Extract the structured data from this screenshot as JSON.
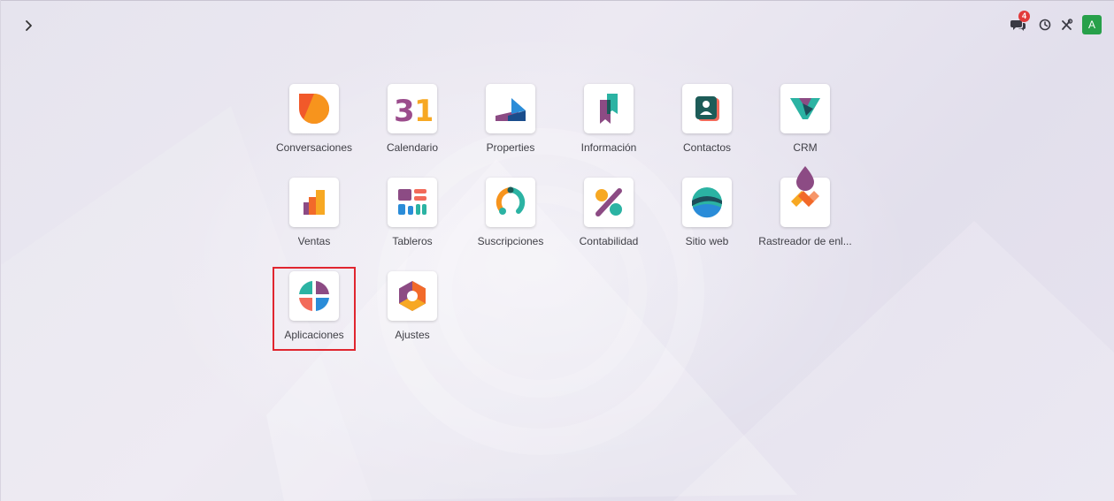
{
  "colors": {
    "badge": "#e23b3b",
    "avatar": "#27a04a",
    "highlight": "#e0262f"
  },
  "header": {
    "menu_toggle_icon": "chevron-right-icon",
    "systray": {
      "messages_icon": "chat-bubbles-icon",
      "messages_count": "4",
      "activity_icon": "clock-icon",
      "tools_icon": "tools-icon",
      "avatar_letter": "A"
    }
  },
  "apps": [
    {
      "label": "Conversaciones",
      "icon": "discuss-icon"
    },
    {
      "label": "Calendario",
      "icon": "calendar-icon",
      "icon_text": "31"
    },
    {
      "label": "Properties",
      "icon": "properties-icon"
    },
    {
      "label": "Información",
      "icon": "knowledge-icon"
    },
    {
      "label": "Contactos",
      "icon": "contacts-icon"
    },
    {
      "label": "CRM",
      "icon": "crm-icon"
    },
    {
      "label": "Ventas",
      "icon": "sales-icon"
    },
    {
      "label": "Tableros",
      "icon": "dashboards-icon"
    },
    {
      "label": "Suscripciones",
      "icon": "subscriptions-icon"
    },
    {
      "label": "Contabilidad",
      "icon": "accounting-icon"
    },
    {
      "label": "Sitio web",
      "icon": "website-icon"
    },
    {
      "label": "Rastreador de enl...",
      "icon": "link-tracker-icon"
    },
    {
      "label": "Aplicaciones",
      "icon": "apps-icon"
    },
    {
      "label": "Ajustes",
      "icon": "settings-icon"
    }
  ]
}
